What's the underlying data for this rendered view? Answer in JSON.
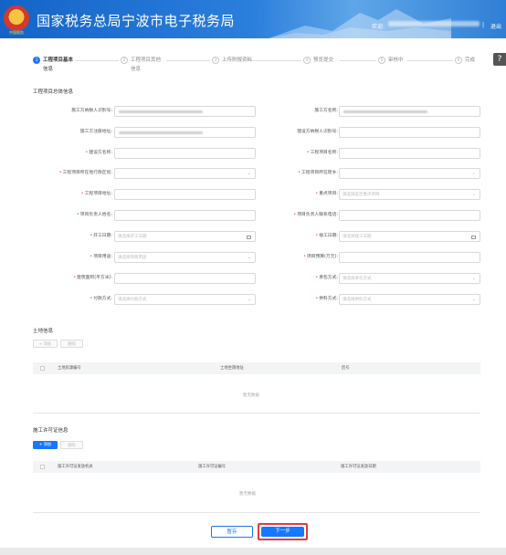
{
  "header": {
    "title": "国家税务总局宁波市电子税务局",
    "logo_text": "中国税务",
    "welcome": "欢迎:",
    "separator": "|",
    "logout": "退出"
  },
  "help_icon": "question-icon",
  "steps": [
    {
      "num": "1",
      "label": "工程项目基本",
      "sub": "信息",
      "active": true
    },
    {
      "num": "2",
      "label": "工程项目其他",
      "sub": "信息",
      "active": false
    },
    {
      "num": "3",
      "label": "上传附报资料",
      "sub": "",
      "active": false
    },
    {
      "num": "4",
      "label": "预览提交",
      "sub": "",
      "active": false
    },
    {
      "num": "5",
      "label": "审核中",
      "sub": "",
      "active": false
    },
    {
      "num": "6",
      "label": "完成",
      "sub": "",
      "active": false
    }
  ],
  "sections": {
    "project_info": "工程项目总体信息",
    "land_info": "土地信息",
    "permit_info": "施工许可证信息"
  },
  "form": {
    "left": [
      {
        "label": "施工方纳税人识别号:",
        "required": false,
        "value": "",
        "blurred": true,
        "type": "text",
        "placeholder": ""
      },
      {
        "label": "施工方注册地址:",
        "required": false,
        "value": "",
        "blurred": true,
        "type": "text",
        "placeholder": ""
      },
      {
        "label": "建设方名称:",
        "required": true,
        "value": "",
        "blurred": false,
        "type": "text",
        "placeholder": ""
      },
      {
        "label": "工程项目所在地行政区划:",
        "required": true,
        "value": "",
        "blurred": false,
        "type": "select",
        "placeholder": ""
      },
      {
        "label": "工程项目地址:",
        "required": true,
        "value": "",
        "blurred": false,
        "type": "text",
        "placeholder": ""
      },
      {
        "label": "项目负责人姓名:",
        "required": true,
        "value": "",
        "blurred": false,
        "type": "text",
        "placeholder": ""
      },
      {
        "label": "开工日期:",
        "required": true,
        "value": "",
        "blurred": false,
        "type": "date",
        "placeholder": "请选择开工日期"
      },
      {
        "label": "项目用途:",
        "required": true,
        "value": "",
        "blurred": false,
        "type": "select",
        "placeholder": "请选择项目用途"
      },
      {
        "label": "建筑面积(平方米):",
        "required": true,
        "value": "",
        "blurred": false,
        "type": "text",
        "placeholder": ""
      },
      {
        "label": "付款方式:",
        "required": true,
        "value": "",
        "blurred": false,
        "type": "select",
        "placeholder": "请选择付款方式"
      }
    ],
    "right": [
      {
        "label": "施工方名称:",
        "required": false,
        "value": "",
        "blurred": true,
        "type": "text",
        "placeholder": ""
      },
      {
        "label": "建设方纳税人识别号:",
        "required": false,
        "value": "",
        "blurred": false,
        "type": "text",
        "placeholder": ""
      },
      {
        "label": "工程项目名称:",
        "required": true,
        "value": "",
        "blurred": false,
        "type": "text",
        "placeholder": ""
      },
      {
        "label": "工程项目所在街乡:",
        "required": true,
        "value": "",
        "blurred": false,
        "type": "select",
        "placeholder": ""
      },
      {
        "label": "重点项目:",
        "required": true,
        "value": "",
        "blurred": false,
        "type": "select",
        "placeholder": "请选择是否重点项目"
      },
      {
        "label": "项目负责人联系电话:",
        "required": true,
        "value": "",
        "blurred": false,
        "type": "text",
        "placeholder": ""
      },
      {
        "label": "竣工日期:",
        "required": true,
        "value": "",
        "blurred": false,
        "type": "date",
        "placeholder": "请选择竣工日期"
      },
      {
        "label": "项目预算(万元):",
        "required": true,
        "value": "",
        "blurred": false,
        "type": "text",
        "placeholder": ""
      },
      {
        "label": "承包方式:",
        "required": true,
        "value": "",
        "blurred": false,
        "type": "select",
        "placeholder": "请选择承包方式"
      },
      {
        "label": "供料方式:",
        "required": true,
        "value": "",
        "blurred": false,
        "type": "select",
        "placeholder": "请选择供料方式"
      }
    ]
  },
  "land_table": {
    "add_label": "+ 添加",
    "delete_label": "删除",
    "columns": [
      "土地房源编号",
      "土地坐落地址",
      "后号"
    ],
    "empty": "暂无数据"
  },
  "permit_table": {
    "add_label": "+ 添加",
    "delete_label": "删除",
    "columns": [
      "施工许可证发放机关",
      "施工许可证编号",
      "施工许可证发放日期"
    ],
    "empty": "暂无数据"
  },
  "actions": {
    "save": "暂存",
    "next": "下一步"
  },
  "colors": {
    "primary": "#1677ff",
    "header": "#2b7fdc",
    "highlight": "#e23b3b",
    "required": "#e55555"
  }
}
